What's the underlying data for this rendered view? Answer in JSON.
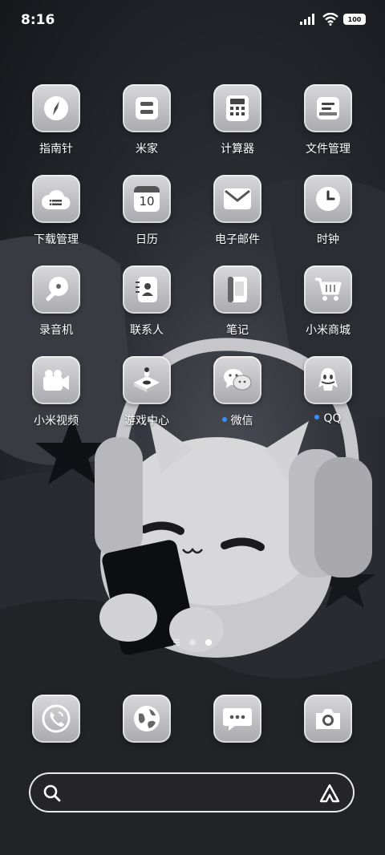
{
  "status_bar": {
    "time": "8:16",
    "battery": "100"
  },
  "apps_row1": [
    {
      "label": "指南针",
      "icon": "compass-icon"
    },
    {
      "label": "米家",
      "icon": "mi-home-icon"
    },
    {
      "label": "计算器",
      "icon": "calculator-icon"
    },
    {
      "label": "文件管理",
      "icon": "file-manager-icon"
    }
  ],
  "apps_row2": [
    {
      "label": "下载管理",
      "icon": "download-cloud-icon"
    },
    {
      "label": "日历",
      "icon": "calendar-icon",
      "day": "10"
    },
    {
      "label": "电子邮件",
      "icon": "mail-icon"
    },
    {
      "label": "时钟",
      "icon": "clock-icon"
    }
  ],
  "apps_row3": [
    {
      "label": "录音机",
      "icon": "recorder-icon"
    },
    {
      "label": "联系人",
      "icon": "contacts-icon"
    },
    {
      "label": "笔记",
      "icon": "notes-icon"
    },
    {
      "label": "小米商城",
      "icon": "cart-icon"
    }
  ],
  "apps_row4": [
    {
      "label": "小米视频",
      "icon": "video-icon"
    },
    {
      "label": "游戏中心",
      "icon": "game-center-icon"
    },
    {
      "label": "微信",
      "icon": "wechat-icon"
    },
    {
      "label": "QQ",
      "icon": "qq-icon"
    }
  ],
  "dock": [
    {
      "icon": "phone-icon"
    },
    {
      "icon": "browser-icon"
    },
    {
      "icon": "messages-icon"
    },
    {
      "icon": "camera-icon"
    }
  ]
}
